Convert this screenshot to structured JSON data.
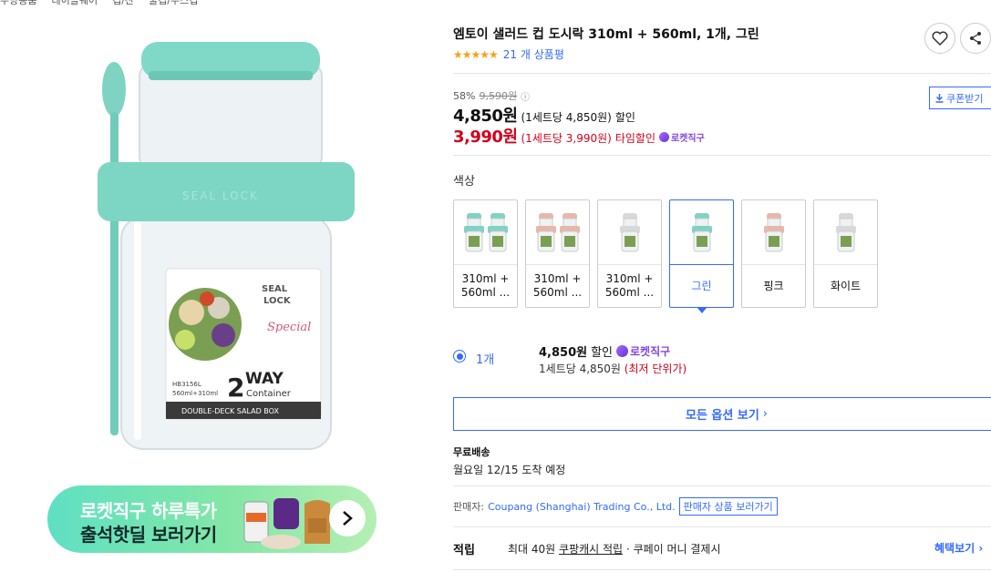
{
  "breadcrumb": [
    "주방용품",
    "테이블웨어",
    "컵/잔",
    "물컵/주스컵"
  ],
  "product": {
    "title": "엠토이 샐러드 컵 도시락 310ml + 560ml, 1개, 그린",
    "rating_count": "21 개 상품평",
    "rating_value": 4.5,
    "image_texts": {
      "brand": "SEAL LOCK",
      "badge": "SEAL\nLOCK",
      "script": "Special",
      "model": "HB3156L",
      "capacity": "560ml+310ml",
      "way_number": "2",
      "way_text": "WAY",
      "container_text": "Container",
      "bottom_band": "DOUBLE-DECK SALAD BOX"
    }
  },
  "pricing": {
    "discount_rate": "58%",
    "original_price": "9,590원",
    "info_icon": "ⓘ",
    "coupon_button": "쿠폰받기",
    "sale_price": "4,850원",
    "sale_unit": "(1세트당 4,850원)",
    "sale_suffix": "할인",
    "time_price": "3,990원",
    "time_unit": "(1세트당 3,990원)",
    "time_suffix": "타임할인",
    "rocket_label": "로켓직구"
  },
  "options": {
    "label": "색상",
    "items": [
      {
        "label": "310ml + 560ml ...",
        "selected": false,
        "colors": [
          "#7fd3c3",
          "#7fd3c3"
        ]
      },
      {
        "label": "310ml + 560ml ...",
        "selected": false,
        "colors": [
          "#e7b7a9",
          "#e7b7a9"
        ]
      },
      {
        "label": "310ml + 560ml ...",
        "selected": false,
        "colors": [
          "#d9d9d9"
        ]
      },
      {
        "label": "그린",
        "selected": true,
        "colors": [
          "#7fd3c3"
        ]
      },
      {
        "label": "핑크",
        "selected": false,
        "colors": [
          "#e7b7a9"
        ]
      },
      {
        "label": "화이트",
        "selected": false,
        "colors": [
          "#d9d9d9"
        ]
      }
    ]
  },
  "quantity": {
    "label": "1개",
    "price": "4,850원",
    "price_suffix": "할인",
    "rocket_label": "로켓직구",
    "unit_price": "1세트당 4,850원",
    "lowest_tag": "(최저 단위가)"
  },
  "all_options_button": "모든 옵션 보기",
  "shipping": {
    "title": "무료배송",
    "arrival": "월요일 12/15 도착 예정"
  },
  "seller": {
    "prefix": "판매자:",
    "name": "Coupang (Shanghai) Trading Co., Ltd.",
    "button": "판매자 상품 보러가기"
  },
  "reward": {
    "title": "적립",
    "desc_prefix": "최대 40원",
    "desc_link": "쿠팡캐시 적립",
    "desc_suffix": "· 쿠페이 머니 결제시",
    "benefit_link": "혜택보기"
  },
  "banner": {
    "line1": "로켓직구 하루특가",
    "line2": "출석핫딜 보러가기"
  },
  "colors": {
    "accent": "#346aff",
    "price_red": "#d0021b",
    "rocket_purple": "#8247e5",
    "mint": "#7fd3c3"
  }
}
